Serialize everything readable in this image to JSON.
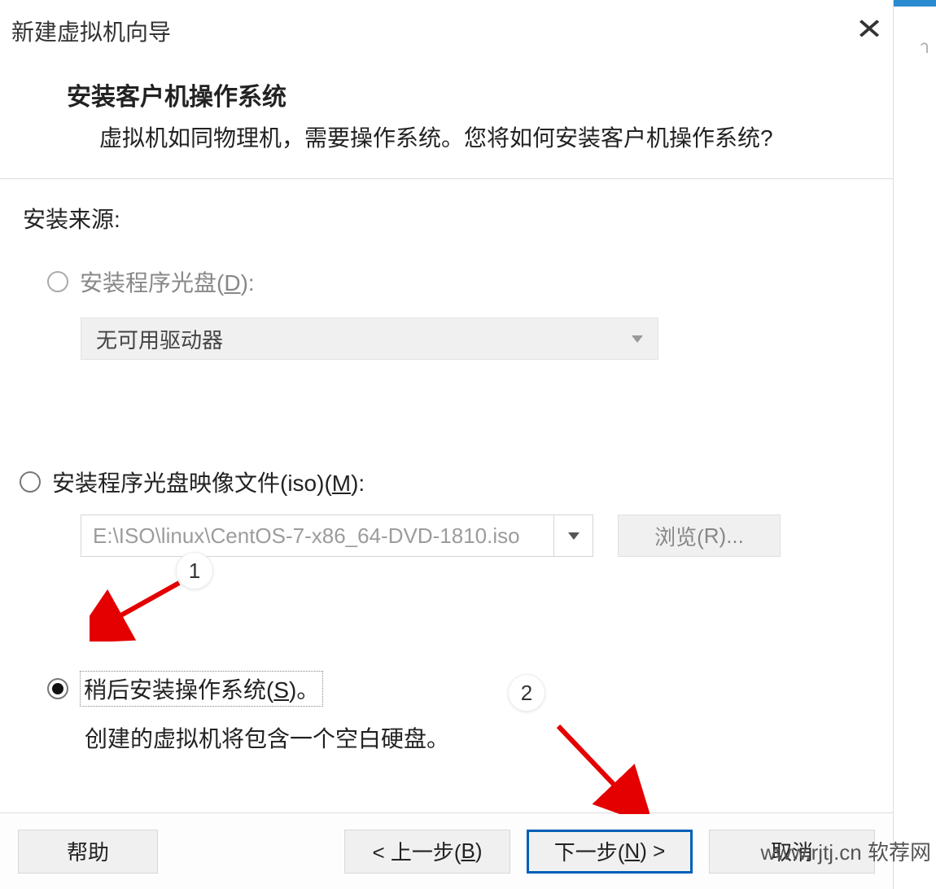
{
  "titlebar": {
    "title": "新建虚拟机向导"
  },
  "header": {
    "title": "安装客户机操作系统",
    "subtitle": "虚拟机如同物理机，需要操作系统。您将如何安装客户机操作系统?"
  },
  "source": {
    "label": "安装来源:",
    "options": {
      "disc": {
        "label_pre": "安装程序光盘(",
        "hotkey": "D",
        "label_post": "):",
        "dropdown_text": "无可用驱动器"
      },
      "iso": {
        "label_pre": "安装程序光盘映像文件(iso)(",
        "hotkey": "M",
        "label_post": "):",
        "path": "E:\\ISO\\linux\\CentOS-7-x86_64-DVD-1810.iso",
        "browse_pre": "浏览(",
        "browse_hotkey": "R",
        "browse_post": ")..."
      },
      "later": {
        "label_pre": "稍后安装操作系统(",
        "hotkey": "S",
        "label_post": ")。",
        "description": "创建的虚拟机将包含一个空白硬盘。"
      }
    }
  },
  "buttons": {
    "help": "帮助",
    "back_pre": "< 上一步(",
    "back_hotkey": "B",
    "back_post": ")",
    "next_pre": "下一步(",
    "next_hotkey": "N",
    "next_post": ") >",
    "cancel": "取消"
  },
  "annotations": {
    "badge1": "1",
    "badge2": "2"
  },
  "watermark": "www.rjtj.cn 软荐网",
  "edge_text": "า"
}
